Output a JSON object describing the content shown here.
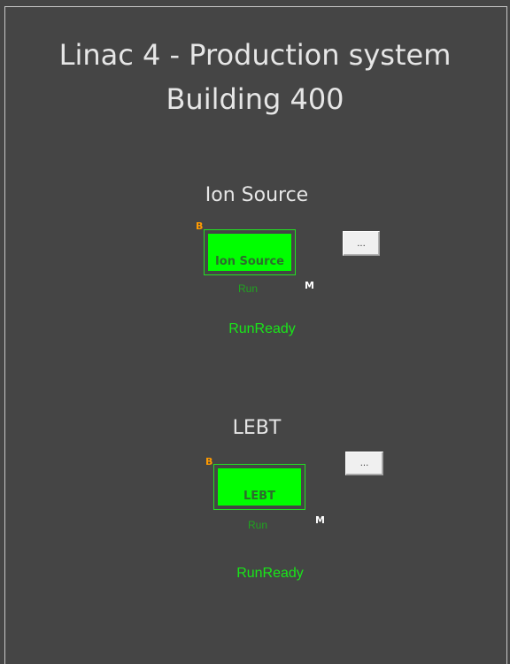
{
  "header": {
    "title_line1": "Linac 4 - Production system",
    "title_line2": "Building 400"
  },
  "sections": [
    {
      "title": "Ion Source",
      "block_label": "Ion Source",
      "badge_b": "B",
      "badge_m": "M",
      "state": "Run",
      "status": "RunReady",
      "more_button": "..."
    },
    {
      "title": "LEBT",
      "block_label": "LEBT",
      "badge_b": "B",
      "badge_m": "M",
      "state": "Run",
      "status": "RunReady",
      "more_button": "..."
    }
  ],
  "colors": {
    "background": "#454545",
    "block_fill": "#00ff00",
    "block_border": "#22e022",
    "badge_b": "#ff9a00",
    "badge_m": "#ffffff",
    "state_text": "#1fa51f",
    "status_text": "#19e619"
  }
}
